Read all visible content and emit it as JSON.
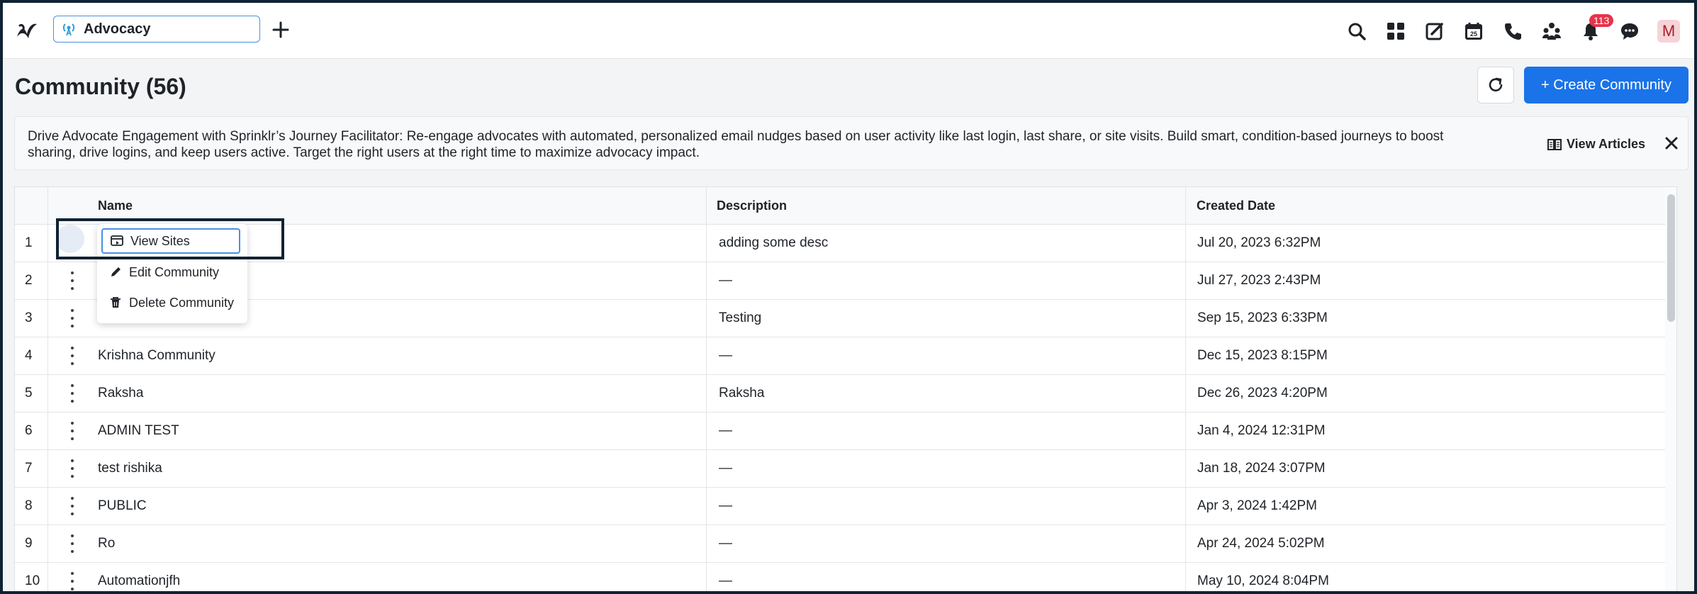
{
  "topbar": {
    "tab_label": "Advocacy",
    "notification_count": "113",
    "avatar_letter": "M"
  },
  "header": {
    "title": "Community (56)",
    "create_label": "+ Create Community"
  },
  "banner": {
    "text": "Drive Advocate Engagement with Sprinklr’s Journey Facilitator: Re-engage advocates with automated, personalized email nudges based on user activity like last login, last share, or site visits. Build smart, condition-based journeys to boost sharing, drive logins, and keep users active. Target the right users at the right time to maximize advocacy impact.",
    "view_articles_label": "View Articles"
  },
  "table": {
    "columns": [
      "Name",
      "Description",
      "Created Date"
    ],
    "rows": [
      {
        "num": "1",
        "name": "",
        "description": "adding some desc",
        "created": "Jul 20, 2023 6:32PM"
      },
      {
        "num": "2",
        "name": "",
        "description": "—",
        "created": "Jul 27, 2023 2:43PM"
      },
      {
        "num": "3",
        "name": "",
        "description": "Testing",
        "created": "Sep 15, 2023 6:33PM"
      },
      {
        "num": "4",
        "name": "Krishna Community",
        "description": "—",
        "created": "Dec 15, 2023 8:15PM"
      },
      {
        "num": "5",
        "name": "Raksha",
        "description": "Raksha",
        "created": "Dec 26, 2023 4:20PM"
      },
      {
        "num": "6",
        "name": "ADMIN TEST",
        "description": "—",
        "created": "Jan 4, 2024 12:31PM"
      },
      {
        "num": "7",
        "name": "test rishika",
        "description": "—",
        "created": "Jan 18, 2024 3:07PM"
      },
      {
        "num": "8",
        "name": "PUBLIC",
        "description": "—",
        "created": "Apr 3, 2024 1:42PM"
      },
      {
        "num": "9",
        "name": "Ro",
        "description": "—",
        "created": "Apr 24, 2024 5:02PM"
      },
      {
        "num": "10",
        "name": "Automationjfh",
        "description": "—",
        "created": "May 10, 2024 8:04PM"
      }
    ]
  },
  "menu": {
    "items": [
      "View Sites",
      "Edit Community",
      "Delete Community"
    ]
  },
  "colors": {
    "accent": "#1a73e8",
    "badge": "#e8334a"
  }
}
